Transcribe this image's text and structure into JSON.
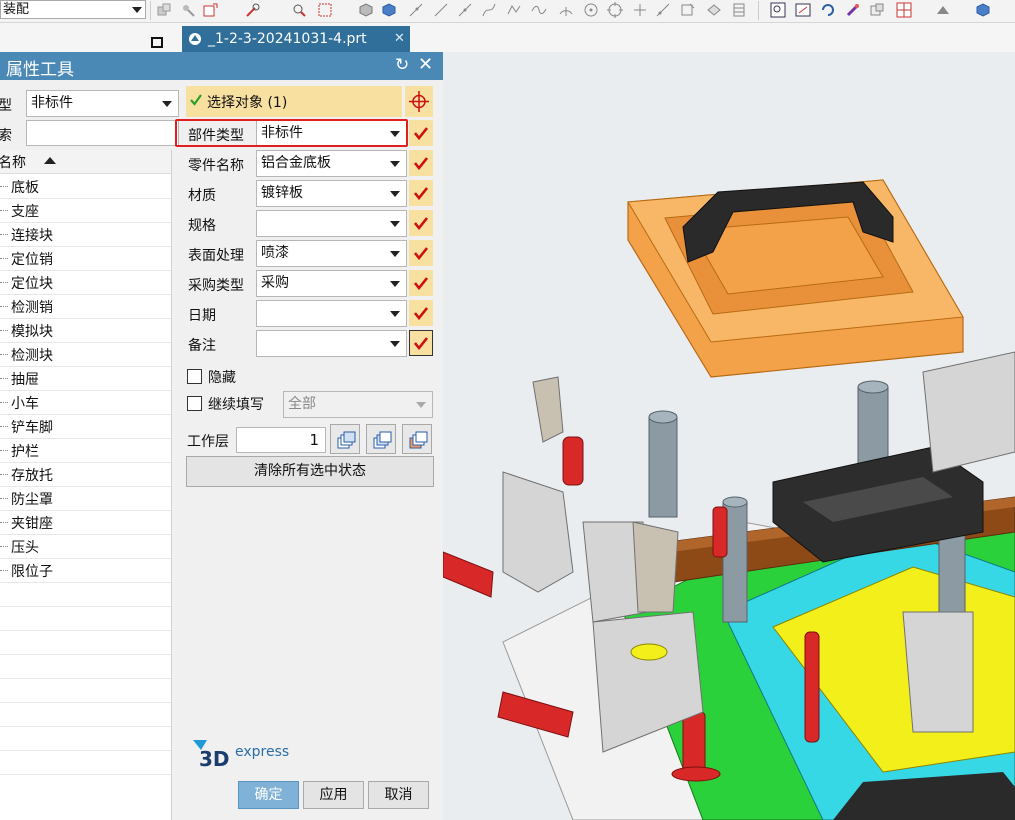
{
  "toolbar": {
    "combo_value": "装配",
    "icons": [
      "assembly-icon",
      "component-icon",
      "move-icon",
      "constraint-icon",
      "select-box-icon",
      "cube-icon",
      "shaded-cube-icon",
      "line-icon",
      "spline-icon",
      "arc-icon",
      "point-icon",
      "circle-icon",
      "crosshair-icon",
      "sketch-icon",
      "layer-icon",
      "render-icon",
      "fit-view-icon",
      "rotate-icon",
      "paint-icon",
      "lighting-icon",
      "view-triad-icon",
      "shading-icon",
      "solid-cube-icon"
    ]
  },
  "file_tab": {
    "label": "_1-2-3-20241031-4.prt",
    "close": "✕"
  },
  "dialog": {
    "title": "属性工具",
    "top": {
      "type_label": "型",
      "type_value": "非标件",
      "search_label": "索"
    },
    "tree": {
      "header": "名称",
      "items": [
        "底板",
        "支座",
        "连接块",
        "定位销",
        "定位块",
        "检测销",
        "模拟块",
        "检测块",
        "抽屉",
        "小车",
        "铲车脚",
        "护栏",
        "存放托",
        "防尘罩",
        "夹钳座",
        "压头",
        "限位子"
      ]
    },
    "select_object": "选择对象 (1)",
    "fields": [
      {
        "label": "部件类型",
        "value": "非标件"
      },
      {
        "label": "零件名称",
        "value": "铝合金底板"
      },
      {
        "label": "材质",
        "value": "镀锌板"
      },
      {
        "label": "规格",
        "value": ""
      },
      {
        "label": "表面处理",
        "value": "喷漆"
      },
      {
        "label": "采购类型",
        "value": "采购"
      },
      {
        "label": "日期",
        "value": ""
      },
      {
        "label": "备注",
        "value": ""
      }
    ],
    "hide_label": "隐藏",
    "continue_label": "继续填写",
    "continue_scope": "全部",
    "work_layer_label": "工作层",
    "work_layer_value": "1",
    "clear_button": "清除所有选中状态",
    "logo_text": "express",
    "logo_mark": "3D",
    "buttons": {
      "ok": "确定",
      "apply": "应用",
      "cancel": "取消"
    }
  },
  "colors": {
    "title_bar": "#4a88b5",
    "tab": "#2f6f9a",
    "field_highlight": "#f8e0a0",
    "checkmark": "#cc1111",
    "select_check": "#2aa12a",
    "red_frame": "#e02020",
    "ok_button": "#7fb2d6"
  }
}
